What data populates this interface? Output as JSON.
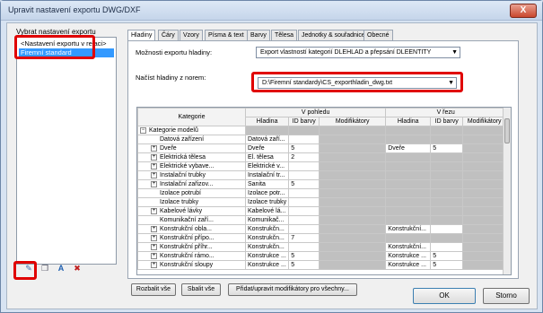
{
  "window": {
    "title": "Upravit nastavení exportu DWG/DXF",
    "close_label": "X"
  },
  "left": {
    "label": "Vybrat nastavení exportu",
    "items": [
      "<Nastavení exportu v relaci>",
      "Firemní standard"
    ],
    "icons": [
      "new-icon",
      "duplicate-icon",
      "rename-icon",
      "delete-icon"
    ]
  },
  "tabs": [
    "Hladiny",
    "Čáry",
    "Vzory",
    "Písma & text",
    "Barvy",
    "Tělesa",
    "Jednotky & souřadnice",
    "Obecné"
  ],
  "options": {
    "label": "Možnosti exportu hladiny:",
    "value": "Export vlastností kategorií DLEHLAD a přepsání DLEENTITY",
    "norm_label": "Načíst hladiny z norem:",
    "norm_value": "D:\\Firemní standardy\\CS_exporthladin_dwg.txt"
  },
  "table": {
    "col_category": "Kategorie",
    "group_view": "V pohledu",
    "group_section": "V řezu",
    "col_layer": "Hladina",
    "col_color": "ID barvy",
    "col_modifiers": "Modifikátory",
    "rows": [
      {
        "cat": "Kategorie modelů",
        "exp": "−",
        "lvl": 0,
        "vl": "",
        "vc": "",
        "vm": "",
        "sl": "",
        "sc": "",
        "sm": "",
        "gray": true
      },
      {
        "cat": "Datová zařízení",
        "exp": "",
        "lvl": 1,
        "vl": "Datová zaří...",
        "vc": "",
        "vm": "",
        "sl": "",
        "sc": "",
        "sm": "",
        "gray": true
      },
      {
        "cat": "Dveře",
        "exp": "+",
        "lvl": 1,
        "vl": "Dveře",
        "vc": "5",
        "vm": "",
        "sl": "Dveře",
        "sc": "5",
        "sm": "",
        "gray": false
      },
      {
        "cat": "Elektrická tělesa",
        "exp": "+",
        "lvl": 1,
        "vl": "El. tělesa",
        "vc": "2",
        "vm": "",
        "sl": "",
        "sc": "",
        "sm": "",
        "gray": true
      },
      {
        "cat": "Elektrické vybave...",
        "exp": "+",
        "lvl": 1,
        "vl": "Elektrické v...",
        "vc": "",
        "vm": "",
        "sl": "",
        "sc": "",
        "sm": "",
        "gray": true
      },
      {
        "cat": "Instalační trubky",
        "exp": "+",
        "lvl": 1,
        "vl": "Instalační tr...",
        "vc": "",
        "vm": "",
        "sl": "",
        "sc": "",
        "sm": "",
        "gray": true
      },
      {
        "cat": "Instalační zařizov...",
        "exp": "+",
        "lvl": 1,
        "vl": "Sanita",
        "vc": "5",
        "vm": "",
        "sl": "",
        "sc": "",
        "sm": "",
        "gray": true
      },
      {
        "cat": "Izolace potrubí",
        "exp": "",
        "lvl": 1,
        "vl": "Izolace potr...",
        "vc": "",
        "vm": "",
        "sl": "",
        "sc": "",
        "sm": "",
        "gray": true
      },
      {
        "cat": "Izolace trubky",
        "exp": "",
        "lvl": 1,
        "vl": "Izolace trubky",
        "vc": "",
        "vm": "",
        "sl": "",
        "sc": "",
        "sm": "",
        "gray": true
      },
      {
        "cat": "Kabelové lávky",
        "exp": "+",
        "lvl": 1,
        "vl": "Kabelové lá...",
        "vc": "",
        "vm": "",
        "sl": "",
        "sc": "",
        "sm": "",
        "gray": true
      },
      {
        "cat": "Komunikační zaří...",
        "exp": "",
        "lvl": 1,
        "vl": "Komunikač...",
        "vc": "",
        "vm": "",
        "sl": "",
        "sc": "",
        "sm": "",
        "gray": true
      },
      {
        "cat": "Konstrukční obla...",
        "exp": "+",
        "lvl": 1,
        "vl": "Konstrukčn...",
        "vc": "",
        "vm": "",
        "sl": "Konstrukční...",
        "sc": "",
        "sm": "",
        "gray": false
      },
      {
        "cat": "Konstrukční přípo...",
        "exp": "+",
        "lvl": 1,
        "vl": "Konstrukčn...",
        "vc": "7",
        "vm": "",
        "sl": "",
        "sc": "",
        "sm": "",
        "gray": true
      },
      {
        "cat": "Konstrukční příhr...",
        "exp": "+",
        "lvl": 1,
        "vl": "Konstrukčn...",
        "vc": "",
        "vm": "",
        "sl": "Konstrukční...",
        "sc": "",
        "sm": "",
        "gray": false
      },
      {
        "cat": "Konstrukční rámo...",
        "exp": "+",
        "lvl": 1,
        "vl": "Konstrukce ...",
        "vc": "5",
        "vm": "",
        "sl": "Konstrukce ...",
        "sc": "5",
        "sm": "",
        "gray": false
      },
      {
        "cat": "Konstrukční sloupy",
        "exp": "+",
        "lvl": 1,
        "vl": "Konstrukce ...",
        "vc": "5",
        "vm": "",
        "sl": "Konstrukce ...",
        "sc": "5",
        "sm": "",
        "gray": false
      }
    ]
  },
  "buttons": {
    "expand": "Rozbalit vše",
    "collapse": "Sbalit vše",
    "modifiers": "Přidat/upravit modifikátory pro všechny...",
    "ok": "OK",
    "cancel": "Storno"
  }
}
